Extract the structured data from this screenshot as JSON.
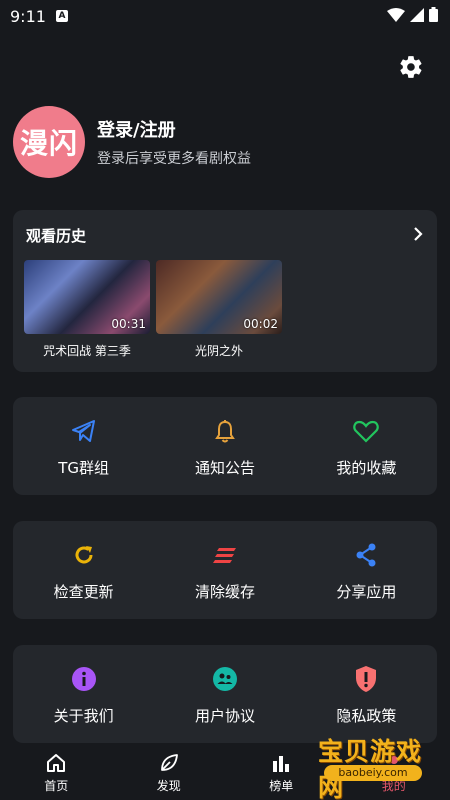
{
  "status_bar": {
    "time": "9:11",
    "notification_letter": "A"
  },
  "profile": {
    "avatar_text": "漫闪",
    "title": "登录/注册",
    "subtitle": "登录后享受更多看剧权益"
  },
  "history": {
    "title": "观看历史",
    "items": [
      {
        "title": "咒术回战 第三季",
        "time": "00:31"
      },
      {
        "title": "光阴之外",
        "time": "00:02"
      }
    ]
  },
  "grid": [
    [
      {
        "label": "TG群组",
        "icon": "telegram-icon",
        "color": "#3b82f6"
      },
      {
        "label": "通知公告",
        "icon": "bell-icon",
        "color": "#e6a23c"
      },
      {
        "label": "我的收藏",
        "icon": "heart-icon",
        "color": "#22c55e"
      }
    ],
    [
      {
        "label": "检查更新",
        "icon": "refresh-icon",
        "color": "#eab308"
      },
      {
        "label": "清除缓存",
        "icon": "clear-icon",
        "color": "#ef4444"
      },
      {
        "label": "分享应用",
        "icon": "share-icon",
        "color": "#3b82f6"
      }
    ],
    [
      {
        "label": "关于我们",
        "icon": "info-icon",
        "color": "#a855f7"
      },
      {
        "label": "用户协议",
        "icon": "agreement-icon",
        "color": "#14b8a6"
      },
      {
        "label": "隐私政策",
        "icon": "shield-icon",
        "color": "#f87171"
      }
    ]
  ],
  "bottom_nav": [
    {
      "label": "首页",
      "icon": "home-icon"
    },
    {
      "label": "发现",
      "icon": "leaf-icon"
    },
    {
      "label": "榜单",
      "icon": "chart-icon"
    },
    {
      "label": "我的",
      "icon": "user-icon",
      "active": true
    }
  ],
  "watermark": {
    "title": "宝贝游戏网",
    "url": "baobeiy.com"
  }
}
